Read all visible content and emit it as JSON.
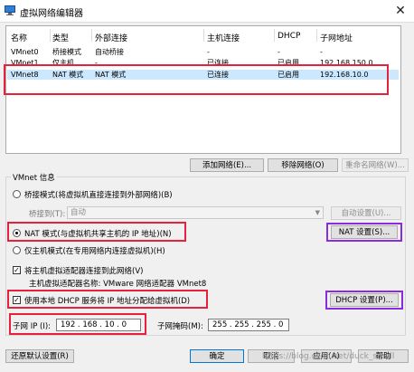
{
  "window": {
    "title": "虚拟网络编辑器",
    "close_glyph": "✕"
  },
  "table": {
    "columns": [
      "名称",
      "类型",
      "外部连接",
      "主机连接",
      "DHCP",
      "子网地址"
    ],
    "rows": [
      [
        "VMnet0",
        "桥接模式",
        "自动桥接",
        "-",
        "-",
        "-"
      ],
      [
        "VMnet1",
        "仅主机...",
        "-",
        "已连接",
        "已启用",
        "192.168.150.0"
      ],
      [
        "VMnet8",
        "NAT 模式",
        "NAT 模式",
        "已连接",
        "已启用",
        "192.168.10.0"
      ]
    ]
  },
  "table_buttons": {
    "add": "添加网络(E)...",
    "remove": "移除网络(O)",
    "rename": "重命名网络(W)..."
  },
  "vmnet_info": {
    "group_label": "VMnet 信息",
    "bridged_mode": "桥接模式(将虚拟机直接连接到外部网络)(B)",
    "bridged_to_label": "桥接到(T):",
    "bridged_to_value": "自动",
    "auto_settings": "自动设置(U)...",
    "nat_mode": "NAT 模式(与虚拟机共享主机的 IP 地址)(N)",
    "nat_settings": "NAT 设置(S)...",
    "host_only": "仅主机模式(在专用网络内连接虚拟机)(H)",
    "connect_adapter": "将主机虚拟适配器连接到此网络(V)",
    "adapter_name": "主机虚拟适配器名称: VMware 网络适配器 VMnet8",
    "use_dhcp": "使用本地 DHCP 服务将 IP 地址分配给虚拟机(D)",
    "dhcp_settings": "DHCP 设置(P)...",
    "subnet_ip_label": "子网 IP (I):",
    "subnet_ip_value": "192 . 168 . 10 . 0",
    "subnet_mask_label": "子网掩码(M):",
    "subnet_mask_value": "255 . 255 . 255 . 0"
  },
  "footer": {
    "restore": "还原默认设置(R)",
    "ok": "确定",
    "cancel": "取消",
    "apply": "应用(A)",
    "help": "帮助"
  },
  "watermark": "https://blog.csdn.net/duck_small"
}
